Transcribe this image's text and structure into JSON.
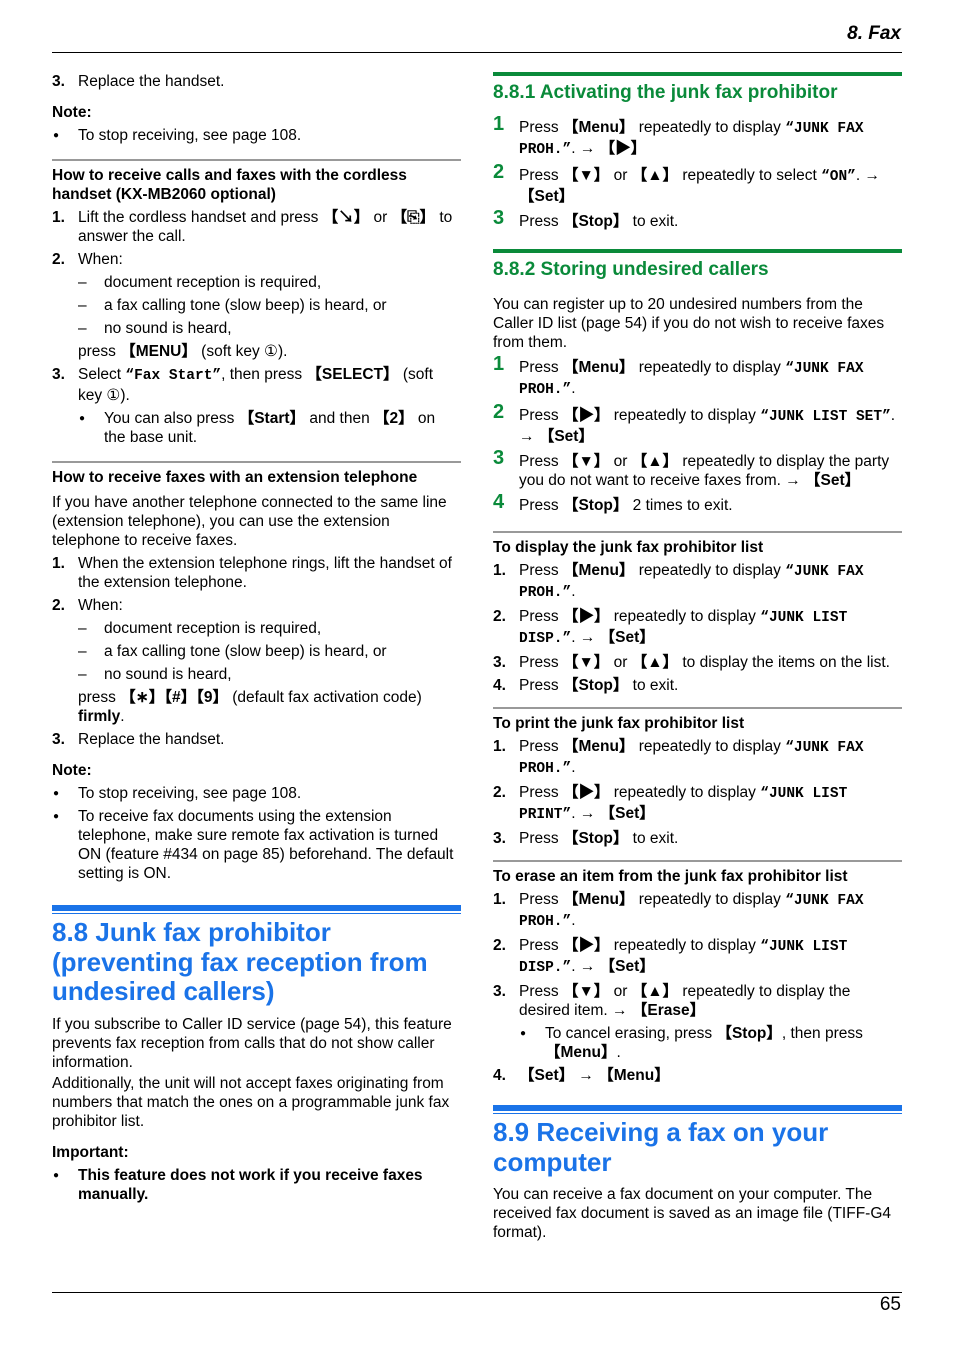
{
  "header": {
    "chapter": "8. Fax",
    "page_number": "65"
  },
  "left": {
    "top_step": {
      "num": "3.",
      "text": "Replace the handset."
    },
    "note1": {
      "label": "Note:",
      "bullets": [
        "To stop receiving, see page 108."
      ]
    },
    "cordless": {
      "heading": "How to receive calls and faxes with the cordless handset (KX-MB2060 optional)",
      "step1": {
        "num": "1.",
        "pre": "Lift the cordless handset and press ",
        "key1": "【↘】",
        "mid": " or ",
        "key2": "【⎘】",
        "post": " to answer the call."
      },
      "step2": {
        "num": "2.",
        "text": "When:",
        "dashes": [
          "document reception is required,",
          "a fax calling tone (slow beep) is heard, or",
          "no sound is heard,"
        ],
        "press_pre": "press ",
        "press_key": "【MENU】",
        "press_post": " (soft key ①)."
      },
      "step3": {
        "num": "3.",
        "pre": "Select ",
        "mono": "“Fax Start”",
        "mid": ", then press ",
        "key": "【SELECT】",
        "post": " (soft key ①).",
        "bullet_pre": "You can also press ",
        "bullet_key1": "【Start】",
        "bullet_mid": " and then ",
        "bullet_key2": "【2】",
        "bullet_post": " on the base unit."
      }
    },
    "extension": {
      "heading": "How to receive faxes with an extension telephone",
      "intro": "If you have another telephone connected to the same line (extension telephone), you can use the extension telephone to receive faxes.",
      "step1": {
        "num": "1.",
        "text": "When the extension telephone rings, lift the handset of the extension telephone."
      },
      "step2": {
        "num": "2.",
        "text": "When:",
        "dashes": [
          "document reception is required,",
          "a fax calling tone (slow beep) is heard, or",
          "no sound is heard,"
        ],
        "press_pre": "press ",
        "press_key": "【∗】【#】【9】",
        "press_post": " (default fax activation code) ",
        "firmly": "firmly",
        "end": "."
      },
      "step3": {
        "num": "3.",
        "text": "Replace the handset."
      },
      "note_label": "Note:",
      "note_bullets": [
        "To stop receiving, see page 108.",
        "To receive fax documents using the extension telephone, make sure remote fax activation is turned ON (feature #434 on page 85) beforehand. The default setting is ON."
      ]
    },
    "section88": {
      "title": "8.8 Junk fax prohibitor (preventing fax reception from undesired callers)",
      "para1": "If you subscribe to Caller ID service (page 54), this feature prevents fax reception from calls that do not show caller information.",
      "para2": "Additionally, the unit will not accept faxes originating from numbers that match the ones on a programmable junk fax prohibitor list.",
      "important_label": "Important:",
      "important_bullet": "This feature does not work if you receive faxes manually."
    }
  },
  "right": {
    "s881": {
      "title": "8.8.1 Activating the junk fax prohibitor",
      "steps": [
        {
          "num": "1",
          "pre": "Press ",
          "key": "【Menu】",
          "mid": " repeatedly to display ",
          "mono": "“JUNK FAX PROH.”",
          "post": ". → ",
          "key2": "【▶】"
        },
        {
          "num": "2",
          "pre": "Press ",
          "key": "【▼】",
          "mid": " or ",
          "key_b": "【▲】",
          "mid2": " repeatedly to select ",
          "mono": "“ON”",
          "post": ". → ",
          "key2": "【Set】"
        },
        {
          "num": "3",
          "pre": "Press ",
          "key": "【Stop】",
          "post": " to exit."
        }
      ]
    },
    "s882": {
      "title": "8.8.2 Storing undesired callers",
      "intro": "You can register up to 20 undesired numbers from the Caller ID list (page 54) if you do not wish to receive faxes from them.",
      "steps": [
        {
          "num": "1",
          "pre": "Press ",
          "key": "【Menu】",
          "mid": " repeatedly to display ",
          "mono": "“JUNK FAX PROH.”",
          "post": "."
        },
        {
          "num": "2",
          "pre": "Press ",
          "key": "【▶】",
          "mid": " repeatedly to display ",
          "mono": "“JUNK LIST SET”",
          "post": ". → ",
          "key2": "【Set】"
        },
        {
          "num": "3",
          "pre": "Press ",
          "key": "【▼】",
          "mid": " or ",
          "key_b": "【▲】",
          "mid2": " repeatedly to display the party you do not want to receive faxes from. → ",
          "key2": "【Set】"
        },
        {
          "num": "4",
          "pre": "Press ",
          "key": "【Stop】",
          "post": " 2 times to exit."
        }
      ]
    },
    "display_list": {
      "heading": "To display the junk fax prohibitor list",
      "steps": [
        {
          "num": "1.",
          "pre": "Press ",
          "key": "【Menu】",
          "mid": " repeatedly to display ",
          "mono": "“JUNK FAX PROH.”",
          "post": "."
        },
        {
          "num": "2.",
          "pre": "Press ",
          "key": "【▶】",
          "mid": " repeatedly to display ",
          "mono": "“JUNK LIST DISP.”",
          "post": ". → ",
          "key2": "【Set】"
        },
        {
          "num": "3.",
          "pre": "Press ",
          "key": "【▼】",
          "mid": " or ",
          "key_b": "【▲】",
          "post": " to display the items on the list."
        },
        {
          "num": "4.",
          "pre": "Press ",
          "key": "【Stop】",
          "post": " to exit."
        }
      ]
    },
    "print_list": {
      "heading": "To print the junk fax prohibitor list",
      "steps": [
        {
          "num": "1.",
          "pre": "Press ",
          "key": "【Menu】",
          "mid": " repeatedly to display ",
          "mono": "“JUNK FAX PROH.”",
          "post": "."
        },
        {
          "num": "2.",
          "pre": "Press ",
          "key": "【▶】",
          "mid": " repeatedly to display ",
          "mono": "“JUNK LIST PRINT”",
          "post": ". → ",
          "key2": "【Set】"
        },
        {
          "num": "3.",
          "pre": "Press ",
          "key": "【Stop】",
          "post": " to exit."
        }
      ]
    },
    "erase_item": {
      "heading": "To erase an item from the junk fax prohibitor list",
      "steps": [
        {
          "num": "1.",
          "pre": "Press ",
          "key": "【Menu】",
          "mid": " repeatedly to display ",
          "mono": "“JUNK FAX PROH.”",
          "post": "."
        },
        {
          "num": "2.",
          "pre": "Press ",
          "key": "【▶】",
          "mid": " repeatedly to display ",
          "mono": "“JUNK LIST DISP.”",
          "post": ". → ",
          "key2": "【Set】"
        },
        {
          "num": "3.",
          "pre": "Press ",
          "key": "【▼】",
          "mid": " or ",
          "key_b": "【▲】",
          "mid2": " repeatedly to display the desired item. → ",
          "key2": "【Erase】"
        },
        {
          "num": "4.",
          "key": "【Set】",
          "post": " → ",
          "key2": "【Menu】"
        }
      ],
      "cancel_bullet": {
        "pre": "To cancel erasing, press ",
        "key": "【Stop】",
        "mid": ", then press ",
        "key2": "【Menu】",
        "post": "."
      }
    },
    "section89": {
      "title": "8.9 Receiving a fax on your computer",
      "para": "You can receive a fax document on your computer. The received fax document is saved as an image file (TIFF-G4 format)."
    }
  },
  "colors": {
    "green": "#0a8a3a",
    "blue": "#1a73e8",
    "subrule": "#999999"
  }
}
